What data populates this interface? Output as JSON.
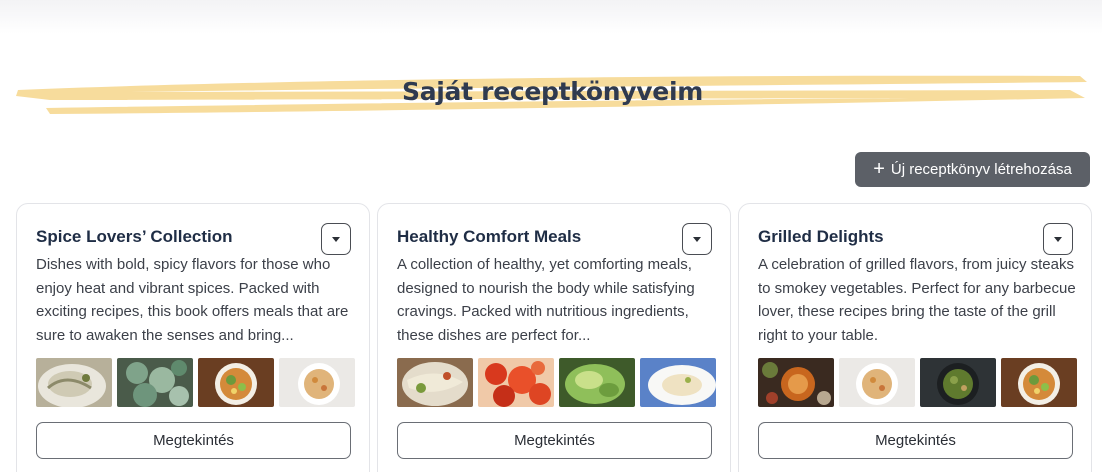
{
  "page_title": "Saját receptkönyveim",
  "create_button": {
    "icon": "plus-icon",
    "label": "Új receptkönyv létrehozása"
  },
  "cards": [
    {
      "title": "Spice Lovers’ Collection",
      "description": "Dishes with bold, spicy flavors for those who enjoy heat and vibrant spices. Packed with exciting recipes, this book offers meals that are sure to awaken the senses and bring...",
      "view_label": "Megtekintés",
      "thumbnails": [
        "creamy-dish",
        "green-broccoli-dish",
        "curry-bowl",
        "rice-pasta-bowl"
      ]
    },
    {
      "title": "Healthy Comfort Meals",
      "description": "A collection of healthy, yet comforting meals, designed to nourish the body while satisfying cravings. Packed with nutritious ingredients, these dishes are perfect for...",
      "view_label": "Megtekintés",
      "thumbnails": [
        "pasta-bake",
        "tomato-stew",
        "avocado-salad",
        "risotto-plate"
      ]
    },
    {
      "title": "Grilled Delights",
      "description": "A celebration of grilled flavors, from juicy steaks to smokey vegetables. Perfect for any barbecue lover, these recipes bring the taste of the grill right to your table.",
      "view_label": "Megtekintés",
      "thumbnails": [
        "curry-spread",
        "rice-pasta-bowl",
        "green-curry",
        "curry-bowl"
      ]
    }
  ]
}
